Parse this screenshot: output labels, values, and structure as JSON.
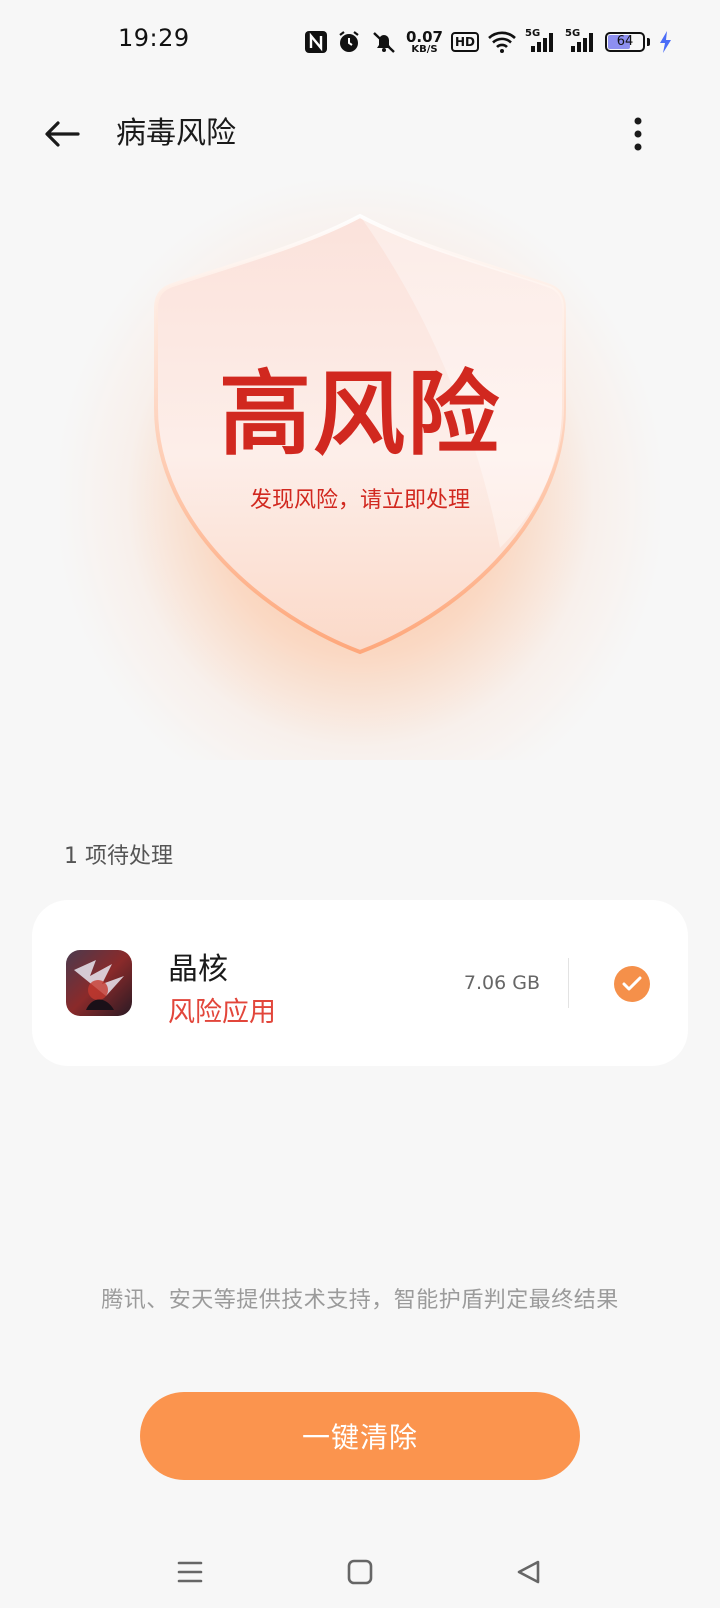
{
  "status_bar": {
    "time": "19:29",
    "net_speed_value": "0.07",
    "net_speed_unit": "KB/S",
    "hd_label": "HD",
    "signal1_label": "5G",
    "signal2_label": "5G",
    "battery_level": "64",
    "icons": [
      "nfc-icon",
      "alarm-icon",
      "mute-icon",
      "wifi-icon",
      "signal-icon",
      "battery-icon",
      "charging-icon"
    ]
  },
  "header": {
    "title": "病毒风险",
    "back_icon": "back-arrow-icon",
    "more_icon": "more-vertical-icon"
  },
  "hero": {
    "risk_level": "高风险",
    "subtitle": "发现风险，请立即处理",
    "accent_color": "#d1281f"
  },
  "pending": {
    "label": "1 项待处理",
    "items": [
      {
        "name": "晶核",
        "status": "风险应用",
        "size": "7.06 GB",
        "checked": true
      }
    ]
  },
  "footer": {
    "tech_note": "腾讯、安天等提供技术支持，智能护盾判定最终结果",
    "action_label": "一键清除",
    "action_color": "#fb944e"
  },
  "nav": {
    "icons": [
      "menu-icon",
      "home-icon",
      "back-icon"
    ]
  }
}
